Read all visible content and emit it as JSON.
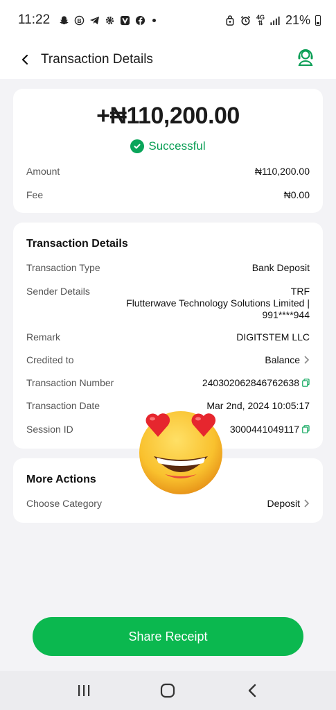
{
  "status_bar": {
    "time": "11:22",
    "battery": "21%",
    "network": "4G"
  },
  "header": {
    "title": "Transaction Details",
    "back_icon": "chevron-left-icon",
    "support_icon": "headset-support-icon"
  },
  "summary": {
    "amount": "+₦110,200.00",
    "status": "Successful",
    "status_color": "#0a9e55",
    "rows": [
      {
        "label": "Amount",
        "value": "₦110,200.00"
      },
      {
        "label": "Fee",
        "value": "₦0.00"
      }
    ]
  },
  "details": {
    "title": "Transaction Details",
    "transaction_type_label": "Transaction Type",
    "transaction_type": "Bank Deposit",
    "sender_label": "Sender Details",
    "sender_line1": "TRF",
    "sender_line2": "Flutterwave Technology Solutions Limited |",
    "sender_line3": "991****944",
    "remark_label": "Remark",
    "remark": "DIGITSTEM LLC",
    "credited_label": "Credited to",
    "credited": "Balance",
    "txn_number_label": "Transaction Number",
    "txn_number": "240302062846762638",
    "txn_date_label": "Transaction Date",
    "txn_date": "Mar 2nd, 2024 10:05:17",
    "session_label": "Session ID",
    "session_id": "3000441049117"
  },
  "more_actions": {
    "title": "More Actions",
    "category_label": "Choose Category",
    "category": "Deposit"
  },
  "share_button": "Share Receipt",
  "accent_color": "#0bb84f"
}
